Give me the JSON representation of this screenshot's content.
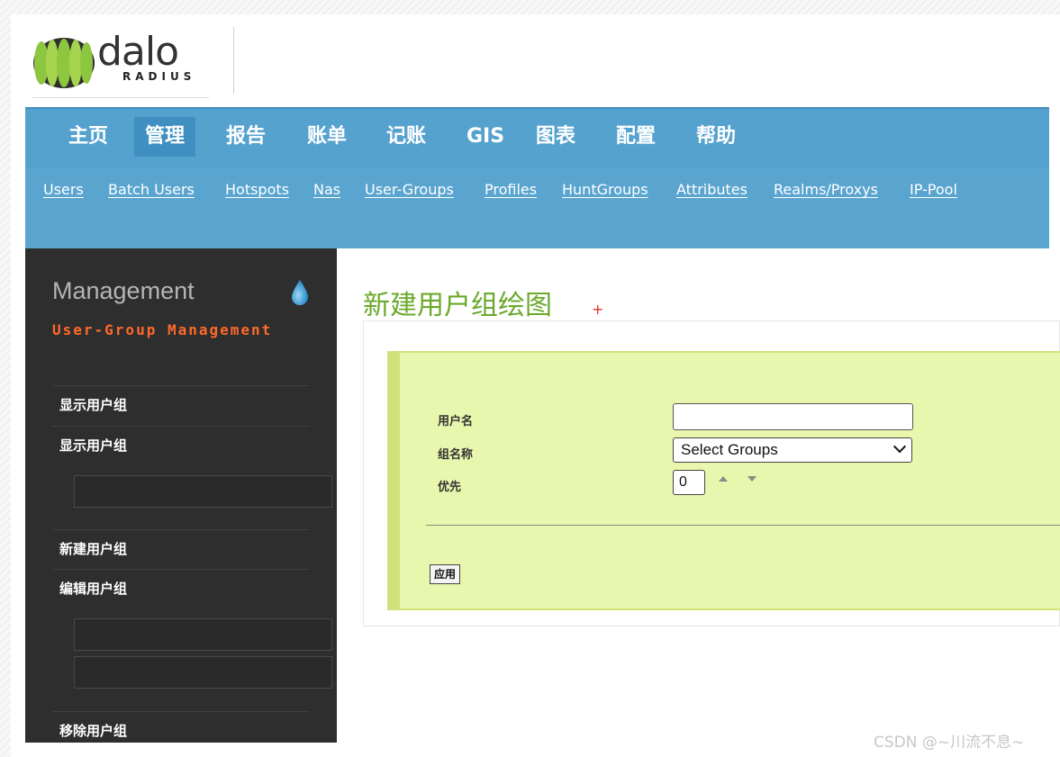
{
  "logo": {
    "wordmark": "dalo",
    "subtext": "RADIUS"
  },
  "main_nav": [
    {
      "label": "主页",
      "active": false
    },
    {
      "label": "管理",
      "active": true
    },
    {
      "label": "报告",
      "active": false
    },
    {
      "label": "账单",
      "active": false
    },
    {
      "label": "记账",
      "active": false
    },
    {
      "label": "GIS",
      "active": false
    },
    {
      "label": "图表",
      "active": false
    },
    {
      "label": "配置",
      "active": false
    },
    {
      "label": "帮助",
      "active": false
    }
  ],
  "sub_nav": [
    "Users",
    "Batch Users",
    "Hotspots",
    "Nas",
    "User-Groups",
    "Profiles",
    "HuntGroups",
    "Attributes",
    "Realms/Proxys",
    "IP-Pool"
  ],
  "sidebar": {
    "title": "Management",
    "subtitle": "User-Group Management",
    "items": [
      "显示用户组",
      "显示用户组",
      "新建用户组",
      "编辑用户组",
      "移除用户组"
    ]
  },
  "content": {
    "title": "新建用户组绘图",
    "plus": "+",
    "form": {
      "username_label": "用户名",
      "username_value": "",
      "group_label": "组名称",
      "group_selected": "Select Groups",
      "priority_label": "优先",
      "priority_value": "0",
      "apply_label": "应用"
    }
  },
  "colors": {
    "nav_bg": "#55a2cf",
    "nav_active": "#3f8fc1",
    "sidebar_bg": "#2e2e2e",
    "sidebar_accent": "#ff6a2a",
    "title_green": "#6aa92b",
    "form_bg": "#e8f7ad"
  },
  "watermark": "CSDN @~川流不息~"
}
